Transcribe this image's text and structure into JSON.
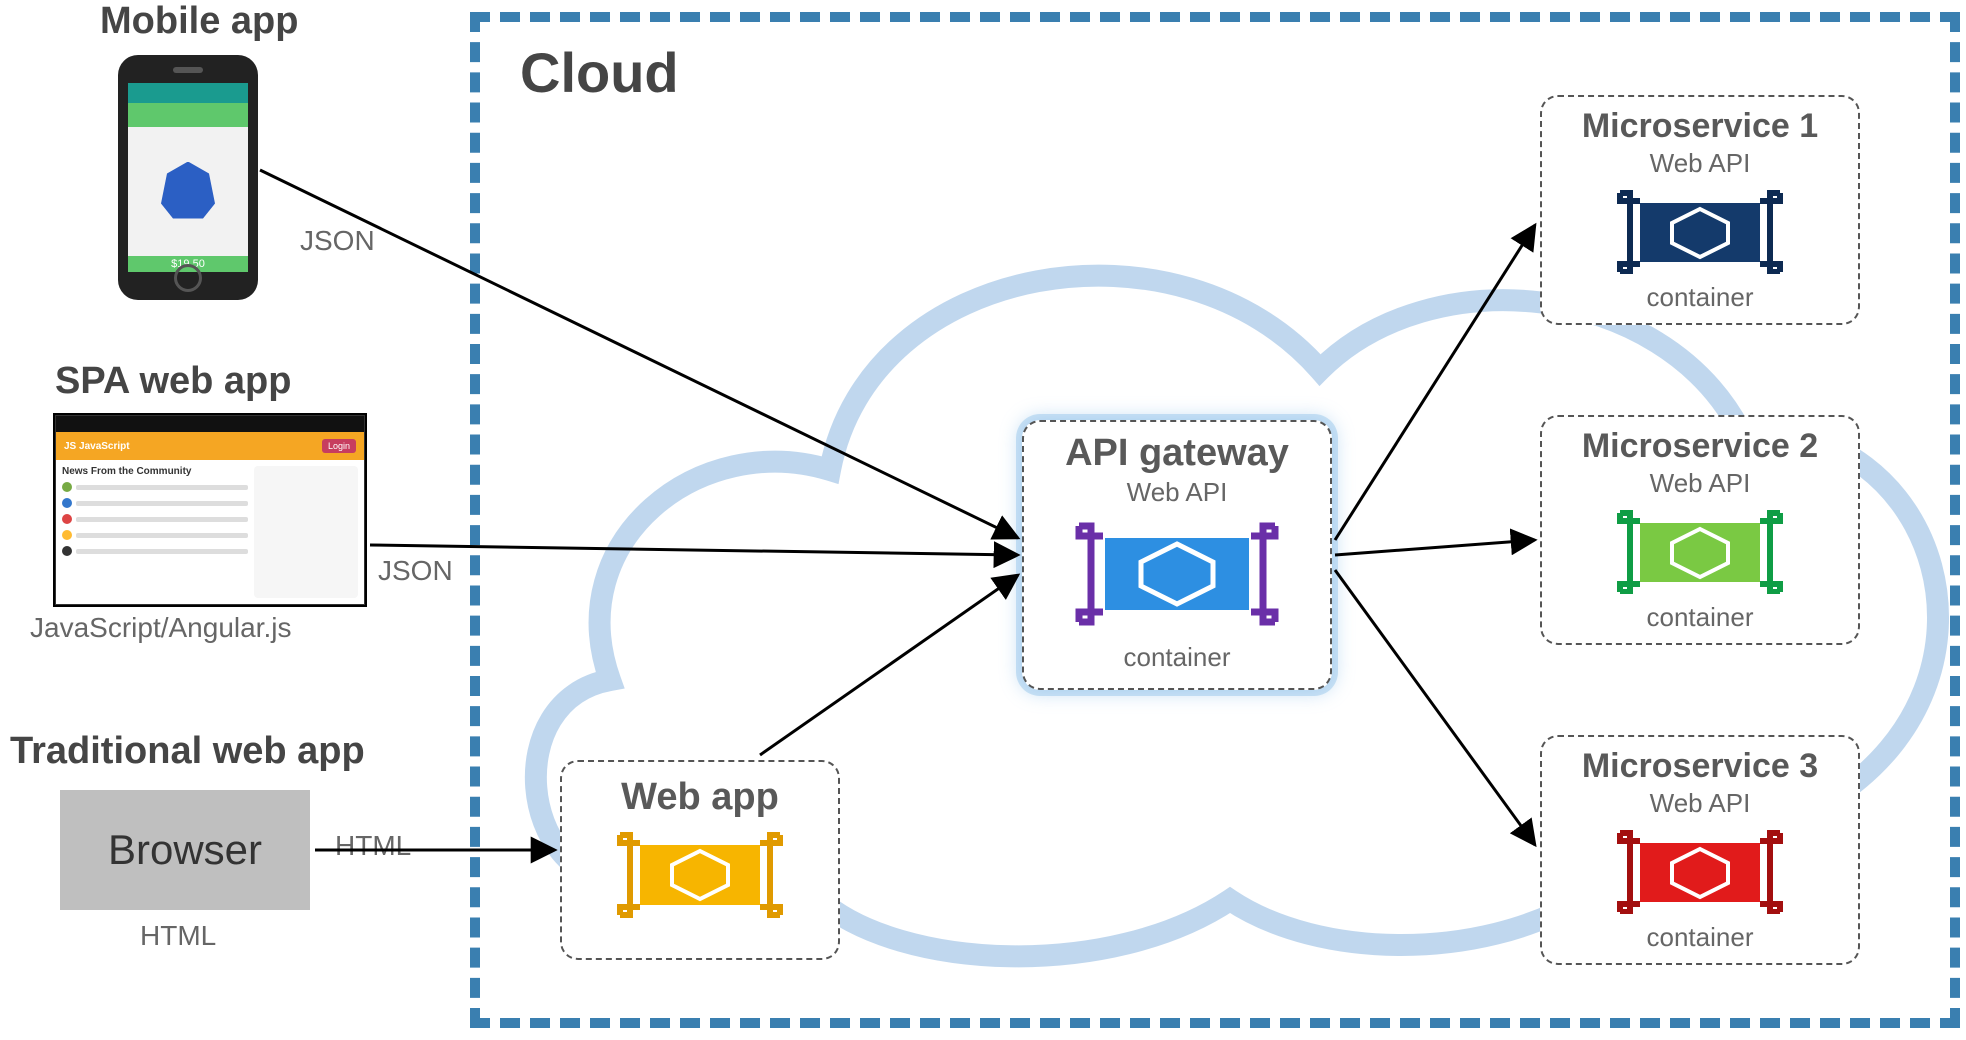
{
  "clients": {
    "mobile": {
      "title": "Mobile app",
      "edge_label": "JSON",
      "price": "$19.50"
    },
    "spa": {
      "title": "SPA web app",
      "sub": "JavaScript/Angular.js",
      "edge_label": "JSON",
      "headline": "News From the Community"
    },
    "browser": {
      "title": "Traditional web app",
      "box": "Browser",
      "sub": "HTML",
      "edge_label": "HTML"
    }
  },
  "cloud": {
    "title": "Cloud",
    "webapp": {
      "title": "Web app"
    },
    "gateway": {
      "title": "API gateway",
      "sub": "Web API",
      "caption": "container"
    },
    "services": [
      {
        "title": "Microservice 1",
        "sub": "Web API",
        "caption": "container",
        "color": "#143a6b",
        "bracket": "#0d2a52"
      },
      {
        "title": "Microservice 2",
        "sub": "Web API",
        "caption": "container",
        "color": "#7ac943",
        "bracket": "#0f9d45"
      },
      {
        "title": "Microservice 3",
        "sub": "Web API",
        "caption": "container",
        "color": "#e11b1b",
        "bracket": "#a30f0f"
      }
    ]
  }
}
